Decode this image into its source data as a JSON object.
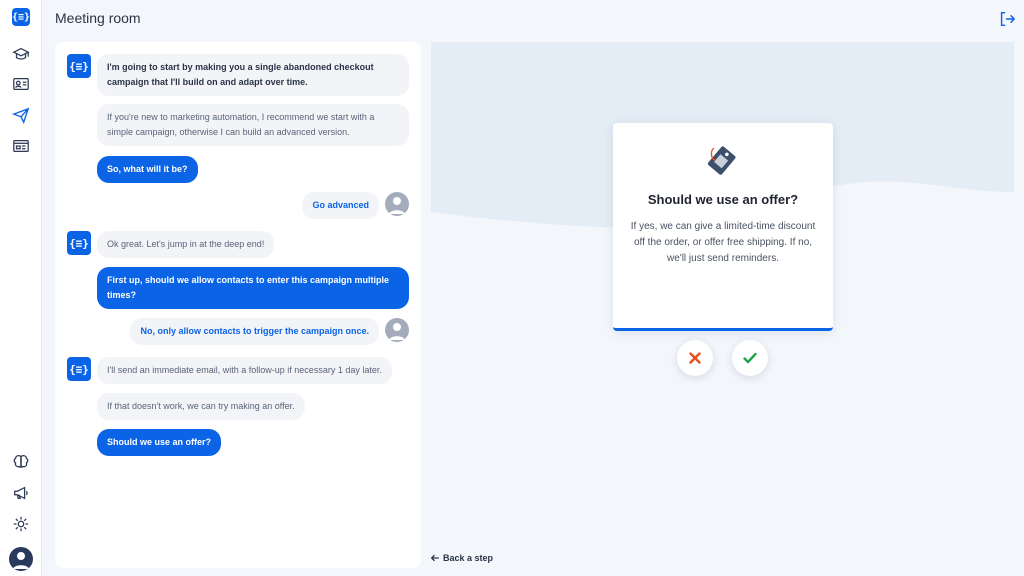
{
  "app": {
    "title": "Meeting room"
  },
  "sidebar": {
    "logo_glyph": "{≡}",
    "items": [
      {
        "name": "learn-icon"
      },
      {
        "name": "contacts-card-icon"
      },
      {
        "name": "campaigns-send-icon"
      },
      {
        "name": "newsletter-icon"
      },
      {
        "name": "brain-icon"
      },
      {
        "name": "megaphone-icon"
      },
      {
        "name": "settings-gear-icon"
      },
      {
        "name": "user-avatar"
      }
    ]
  },
  "chat": {
    "bot_glyph": "{≡}",
    "messages": [
      {
        "from": "bot",
        "style": "bold",
        "text": "I'm going to start by making you a single abandoned checkout campaign that I'll build on and adapt over time."
      },
      {
        "from": "bot",
        "style": "grey",
        "text": "If you're new to marketing automation, I recommend we start with a simple campaign, otherwise I can build an advanced version."
      },
      {
        "from": "bot",
        "style": "blue",
        "text": "So, what will it be?"
      },
      {
        "from": "user",
        "text": "Go advanced"
      },
      {
        "from": "bot",
        "style": "grey",
        "text": "Ok great. Let's jump in at the deep end!"
      },
      {
        "from": "bot",
        "style": "blue",
        "text": "First up, should we allow contacts to enter this campaign multiple times?"
      },
      {
        "from": "user",
        "text": "No, only allow contacts to trigger the campaign once."
      },
      {
        "from": "bot",
        "style": "grey",
        "text": "I'll send an immediate email, with a follow-up if necessary 1 day later."
      },
      {
        "from": "bot",
        "style": "grey",
        "text": "If that doesn't work, we can try making an offer."
      },
      {
        "from": "bot",
        "style": "blue",
        "text": "Should we use an offer?"
      }
    ]
  },
  "card": {
    "icon": "price-tag-icon",
    "title": "Should we use an offer?",
    "body": "If yes, we can give a limited-time discount off the order, or offer free shipping. If no, we'll just send reminders."
  },
  "choices": {
    "no_icon": "cross-icon",
    "yes_icon": "check-icon"
  },
  "footer": {
    "back_label": "Back a step",
    "back_icon": "arrow-left-icon"
  },
  "colors": {
    "accent": "#0b63e5",
    "no": "#e8501e",
    "yes": "#1fa34a",
    "background": "#f3f6fb"
  }
}
